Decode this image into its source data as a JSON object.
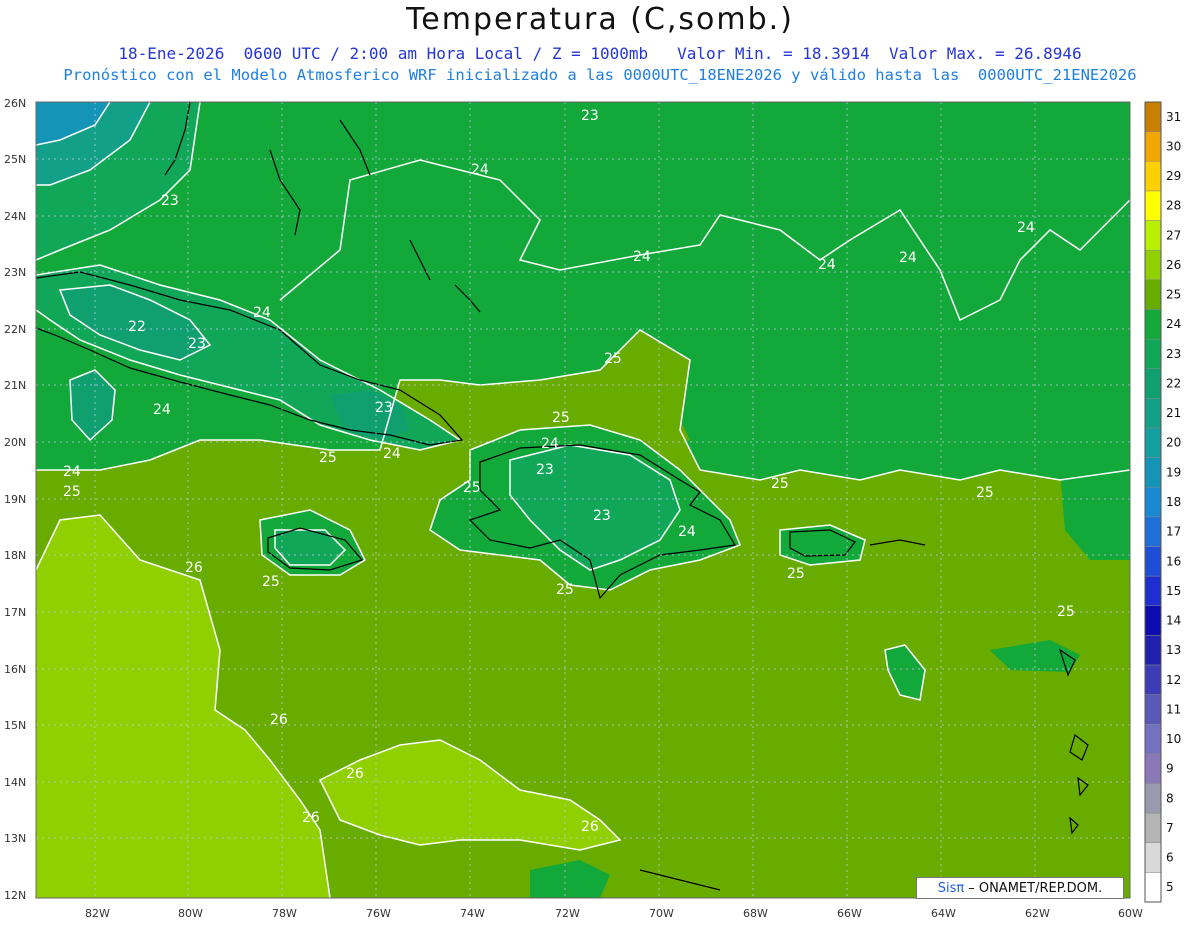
{
  "title": "Temperatura (C,somb.)",
  "subtitle_line1": "18-Ene-2026  0600 UTC / 2:00 am Hora Local / Z = 1000mb   Valor Min. = 18.3914  Valor Max. = 26.8946",
  "subtitle_line2": "Pronóstico con el Modelo Atmosferico WRF inicializado a las 0000UTC_18ENE2026 y válido hasta las  0000UTC_21ENE2026",
  "credit": {
    "brand": "Sisπ",
    "text": "– ONAMET/REP.DOM."
  },
  "lat_labels": [
    "26N",
    "25N",
    "24N",
    "23N",
    "22N",
    "21N",
    "20N",
    "19N",
    "18N",
    "17N",
    "16N",
    "15N",
    "14N",
    "13N",
    "12N"
  ],
  "lon_labels": [
    "82W",
    "80W",
    "78W",
    "76W",
    "74W",
    "72W",
    "70W",
    "68W",
    "66W",
    "64W",
    "62W",
    "60W"
  ],
  "colorbar": {
    "levels": [
      "5",
      "6",
      "7",
      "8",
      "9",
      "10",
      "11",
      "12",
      "13",
      "14",
      "15",
      "16",
      "17",
      "18",
      "19",
      "20",
      "21",
      "22",
      "23",
      "24",
      "25",
      "26",
      "27",
      "28",
      "29",
      "30",
      "31"
    ],
    "colors": [
      "#ffffff",
      "#d9d9d9",
      "#b4b4b4",
      "#9a9aae",
      "#8a78b8",
      "#7272c0",
      "#5959b8",
      "#3c3cb4",
      "#2020b0",
      "#0c0cb0",
      "#1e2ed0",
      "#1e4ed8",
      "#1e70d8",
      "#1a8ad0",
      "#1495b8",
      "#12a0a0",
      "#12a088",
      "#10a070",
      "#10a858",
      "#12a83a",
      "#68ac00",
      "#90d000",
      "#b8f000",
      "#ffff00",
      "#ffd000",
      "#f0a800",
      "#c88000"
    ]
  },
  "contour_labels": [
    "23",
    "24",
    "24",
    "24",
    "24",
    "24",
    "23",
    "22",
    "23",
    "24",
    "23",
    "24",
    "25",
    "25",
    "24",
    "24",
    "25",
    "25",
    "25",
    "25",
    "25",
    "24",
    "23",
    "23",
    "24",
    "25",
    "25",
    "25",
    "25",
    "26",
    "26",
    "26",
    "26",
    "26",
    "25"
  ],
  "colors": {
    "t22": "#10a070",
    "t23": "#10a858",
    "t24": "#12a83a",
    "t25": "#68ac00",
    "t26": "#90d000"
  }
}
